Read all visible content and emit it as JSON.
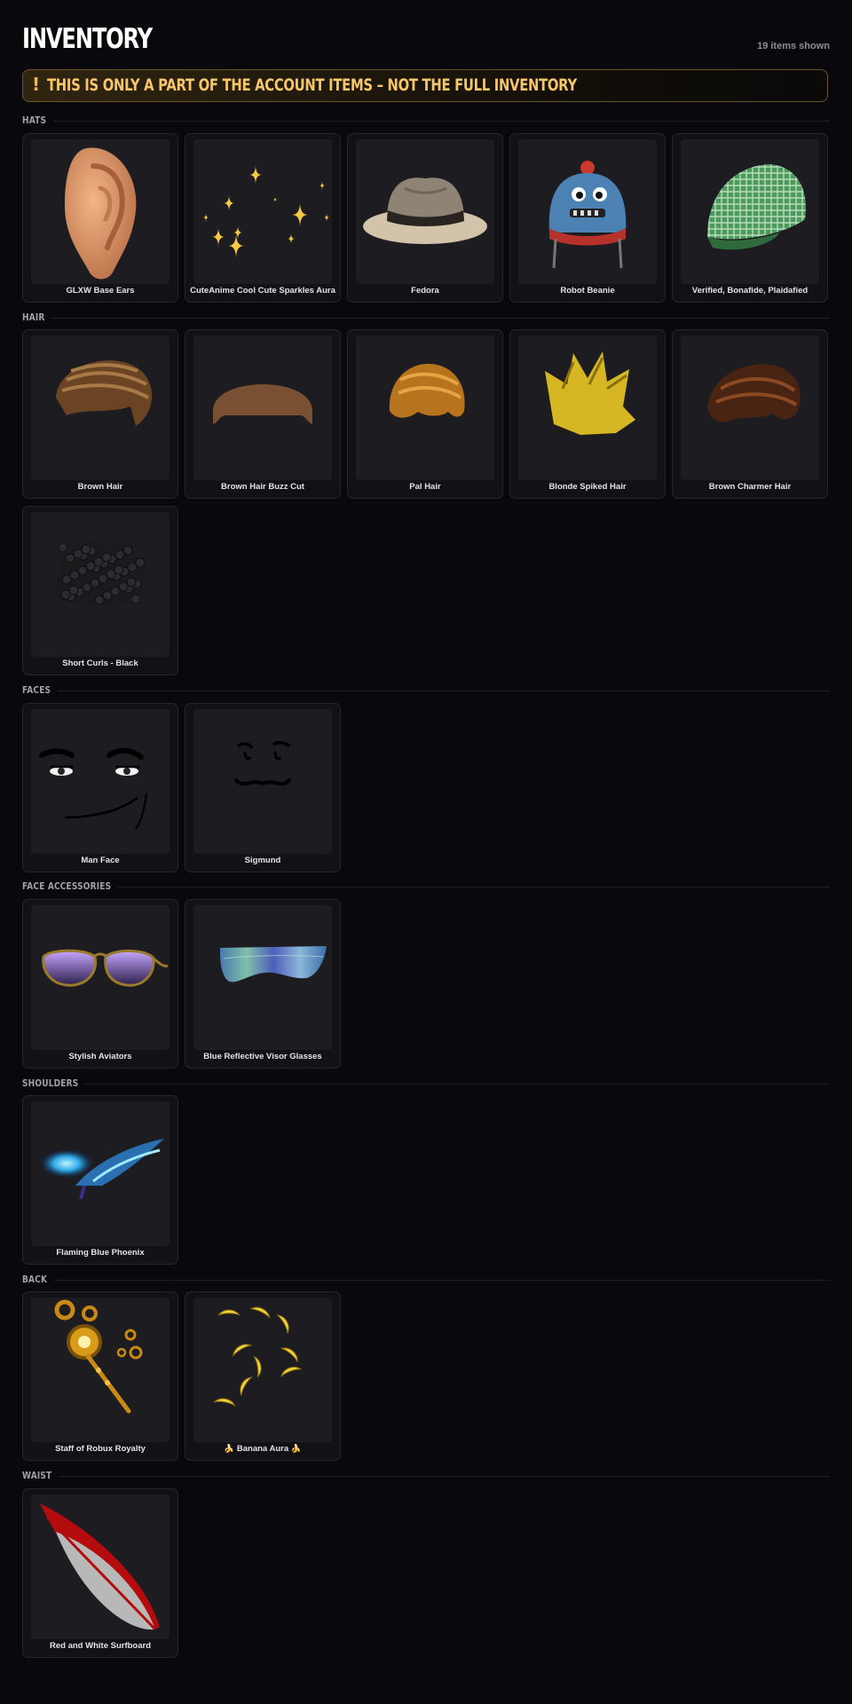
{
  "header": {
    "title": "INVENTORY",
    "count": "19 items shown"
  },
  "banner": {
    "icon": "exclamation-icon",
    "icon_glyph": "!",
    "text": "THIS IS ONLY A PART OF THE ACCOUNT ITEMS – NOT THE FULL INVENTORY"
  },
  "sections": [
    {
      "title": "HATS",
      "items": [
        {
          "name": "GLXW Base Ears",
          "icon": "ear-icon"
        },
        {
          "name": "CuteAnime Cool Cute Sparkles Aura",
          "icon": "sparkles-icon"
        },
        {
          "name": "Fedora",
          "icon": "fedora-hat-icon"
        },
        {
          "name": "Robot Beanie",
          "icon": "robot-beanie-icon"
        },
        {
          "name": "Verified, Bonafide, Plaidafied",
          "icon": "plaid-cap-icon"
        }
      ]
    },
    {
      "title": "HAIR",
      "items": [
        {
          "name": "Brown Hair",
          "icon": "brown-hair-icon"
        },
        {
          "name": "Brown Hair Buzz Cut",
          "icon": "buzz-cut-icon"
        },
        {
          "name": "Pal Hair",
          "icon": "pal-hair-icon"
        },
        {
          "name": "Blonde Spiked Hair",
          "icon": "spiked-hair-icon"
        },
        {
          "name": "Brown Charmer Hair",
          "icon": "charmer-hair-icon"
        },
        {
          "name": "Short Curls - Black",
          "icon": "curly-hair-icon"
        }
      ]
    },
    {
      "title": "FACES",
      "items": [
        {
          "name": "Man Face",
          "icon": "man-face-icon"
        },
        {
          "name": "Sigmund",
          "icon": "mustache-face-icon"
        }
      ]
    },
    {
      "title": "FACE ACCESSORIES",
      "items": [
        {
          "name": "Stylish Aviators",
          "icon": "aviator-glasses-icon"
        },
        {
          "name": "Blue Reflective Visor Glasses",
          "icon": "visor-glasses-icon"
        }
      ]
    },
    {
      "title": "SHOULDERS",
      "items": [
        {
          "name": "Flaming Blue Phoenix",
          "icon": "phoenix-icon"
        }
      ]
    },
    {
      "title": "BACK",
      "items": [
        {
          "name": "Staff of Robux Royalty",
          "icon": "staff-icon"
        },
        {
          "name": "🍌 Banana Aura 🍌",
          "icon": "banana-aura-icon"
        }
      ]
    },
    {
      "title": "WAIST",
      "items": [
        {
          "name": "Red and White Surfboard",
          "icon": "surfboard-icon"
        }
      ]
    }
  ],
  "colors": {
    "background": "#08080d",
    "card": "#111116",
    "thumb": "#1c1c21",
    "accent": "#f7c66b"
  }
}
